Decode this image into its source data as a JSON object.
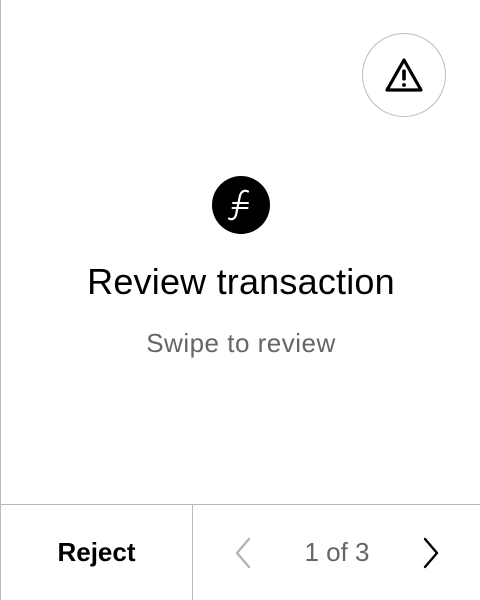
{
  "header": {
    "warning_icon": "warning-triangle-icon"
  },
  "main": {
    "coin_icon": "filecoin-icon",
    "coin_symbol": "⨎",
    "title": "Review transaction",
    "subtitle": "Swipe to review"
  },
  "footer": {
    "reject_label": "Reject",
    "prev_icon": "chevron-left-icon",
    "next_icon": "chevron-right-icon",
    "page_indicator": "1 of 3"
  },
  "colors": {
    "text_primary": "#000000",
    "text_secondary": "#666666",
    "divider": "#b8b8b8",
    "disabled_icon": "#b3b3b3"
  }
}
